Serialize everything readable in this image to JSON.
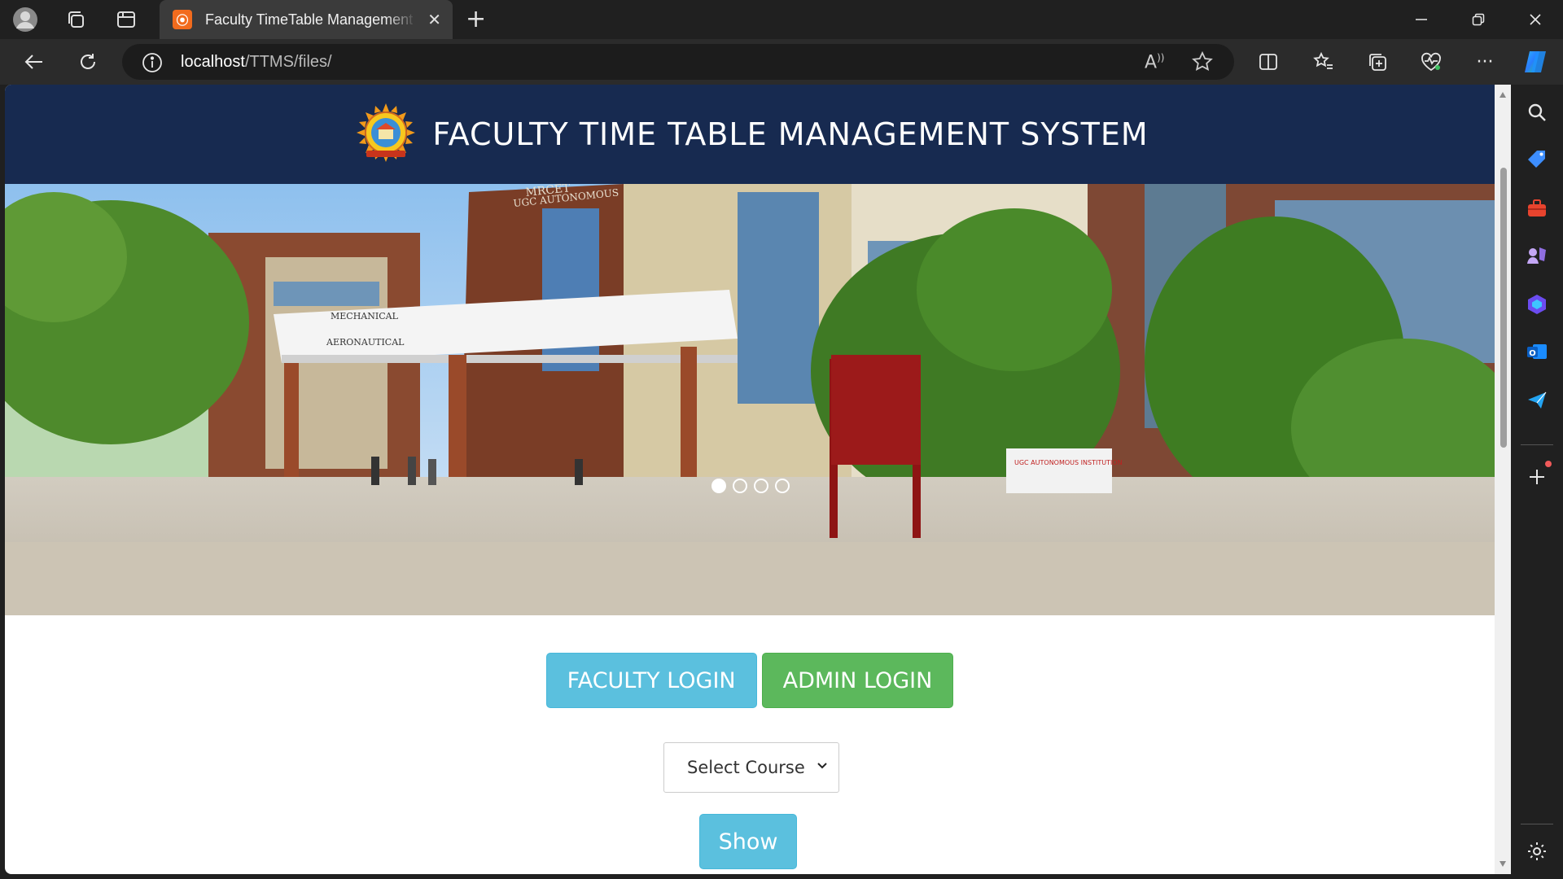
{
  "browser": {
    "tab_title": "Faculty TimeTable Management System",
    "tab_favicon_glyph": "⦿",
    "url_host": "localhost",
    "url_path": "/TTMS/files/"
  },
  "page": {
    "title": "FACULTY TIME TABLE MANAGEMENT SYSTEM",
    "buttons": {
      "faculty_login": "FACULTY LOGIN",
      "admin_login": "ADMIN LOGIN",
      "show": "Show"
    },
    "course_select": {
      "selected": "Select Course"
    },
    "carousel": {
      "slide_count": 4,
      "active_slide": 1,
      "building_signs": [
        "MRCET",
        "UGC AUTONOMOUS",
        "MECHANICAL & AERONAUTICAL",
        "UGC AUTONOMOUS INSTITUTION"
      ]
    }
  },
  "colors": {
    "header_bg": "#172a50",
    "faculty_btn": "#5bc0de",
    "admin_btn": "#5cb85c",
    "show_btn": "#5bc0de",
    "chrome_bg": "#202020"
  },
  "icons": {
    "chrome": [
      "profile-icon",
      "workspaces-icon",
      "tab-actions-icon",
      "new-tab-icon",
      "minimize-icon",
      "restore-icon",
      "close-icon",
      "back-icon",
      "refresh-icon",
      "info-icon",
      "read-aloud-icon",
      "favorite-star-icon",
      "split-screen-icon",
      "favorites-icon",
      "collections-icon",
      "browser-essentials-icon",
      "more-icon",
      "copilot-icon"
    ],
    "sidebar": [
      "search-icon",
      "shopping-icon",
      "tools-icon",
      "games-icon",
      "microsoft365-icon",
      "outlook-icon",
      "drop-icon",
      "add-icon",
      "settings-icon"
    ]
  }
}
